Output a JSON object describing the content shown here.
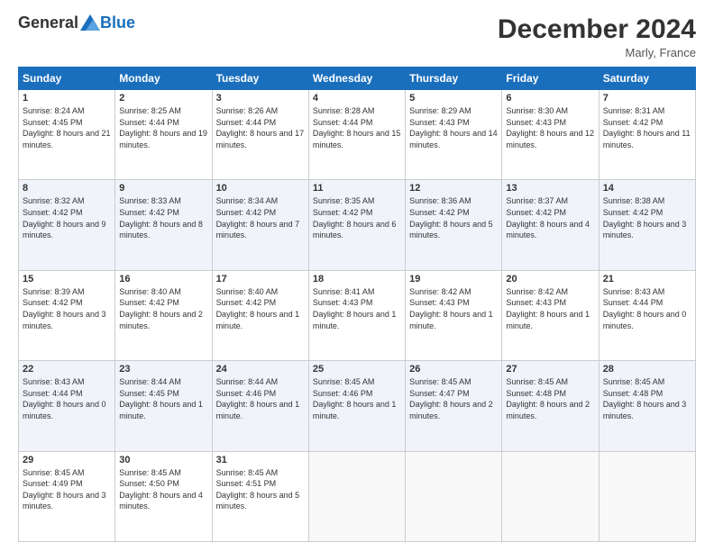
{
  "header": {
    "logo_general": "General",
    "logo_blue": "Blue",
    "month_title": "December 2024",
    "location": "Marly, France"
  },
  "days_of_week": [
    "Sunday",
    "Monday",
    "Tuesday",
    "Wednesday",
    "Thursday",
    "Friday",
    "Saturday"
  ],
  "weeks": [
    [
      {
        "day": "1",
        "info": "Sunrise: 8:24 AM\nSunset: 4:45 PM\nDaylight: 8 hours and 21 minutes."
      },
      {
        "day": "2",
        "info": "Sunrise: 8:25 AM\nSunset: 4:44 PM\nDaylight: 8 hours and 19 minutes."
      },
      {
        "day": "3",
        "info": "Sunrise: 8:26 AM\nSunset: 4:44 PM\nDaylight: 8 hours and 17 minutes."
      },
      {
        "day": "4",
        "info": "Sunrise: 8:28 AM\nSunset: 4:44 PM\nDaylight: 8 hours and 15 minutes."
      },
      {
        "day": "5",
        "info": "Sunrise: 8:29 AM\nSunset: 4:43 PM\nDaylight: 8 hours and 14 minutes."
      },
      {
        "day": "6",
        "info": "Sunrise: 8:30 AM\nSunset: 4:43 PM\nDaylight: 8 hours and 12 minutes."
      },
      {
        "day": "7",
        "info": "Sunrise: 8:31 AM\nSunset: 4:42 PM\nDaylight: 8 hours and 11 minutes."
      }
    ],
    [
      {
        "day": "8",
        "info": "Sunrise: 8:32 AM\nSunset: 4:42 PM\nDaylight: 8 hours and 9 minutes."
      },
      {
        "day": "9",
        "info": "Sunrise: 8:33 AM\nSunset: 4:42 PM\nDaylight: 8 hours and 8 minutes."
      },
      {
        "day": "10",
        "info": "Sunrise: 8:34 AM\nSunset: 4:42 PM\nDaylight: 8 hours and 7 minutes."
      },
      {
        "day": "11",
        "info": "Sunrise: 8:35 AM\nSunset: 4:42 PM\nDaylight: 8 hours and 6 minutes."
      },
      {
        "day": "12",
        "info": "Sunrise: 8:36 AM\nSunset: 4:42 PM\nDaylight: 8 hours and 5 minutes."
      },
      {
        "day": "13",
        "info": "Sunrise: 8:37 AM\nSunset: 4:42 PM\nDaylight: 8 hours and 4 minutes."
      },
      {
        "day": "14",
        "info": "Sunrise: 8:38 AM\nSunset: 4:42 PM\nDaylight: 8 hours and 3 minutes."
      }
    ],
    [
      {
        "day": "15",
        "info": "Sunrise: 8:39 AM\nSunset: 4:42 PM\nDaylight: 8 hours and 3 minutes."
      },
      {
        "day": "16",
        "info": "Sunrise: 8:40 AM\nSunset: 4:42 PM\nDaylight: 8 hours and 2 minutes."
      },
      {
        "day": "17",
        "info": "Sunrise: 8:40 AM\nSunset: 4:42 PM\nDaylight: 8 hours and 1 minute."
      },
      {
        "day": "18",
        "info": "Sunrise: 8:41 AM\nSunset: 4:43 PM\nDaylight: 8 hours and 1 minute."
      },
      {
        "day": "19",
        "info": "Sunrise: 8:42 AM\nSunset: 4:43 PM\nDaylight: 8 hours and 1 minute."
      },
      {
        "day": "20",
        "info": "Sunrise: 8:42 AM\nSunset: 4:43 PM\nDaylight: 8 hours and 1 minute."
      },
      {
        "day": "21",
        "info": "Sunrise: 8:43 AM\nSunset: 4:44 PM\nDaylight: 8 hours and 0 minutes."
      }
    ],
    [
      {
        "day": "22",
        "info": "Sunrise: 8:43 AM\nSunset: 4:44 PM\nDaylight: 8 hours and 0 minutes."
      },
      {
        "day": "23",
        "info": "Sunrise: 8:44 AM\nSunset: 4:45 PM\nDaylight: 8 hours and 1 minute."
      },
      {
        "day": "24",
        "info": "Sunrise: 8:44 AM\nSunset: 4:46 PM\nDaylight: 8 hours and 1 minute."
      },
      {
        "day": "25",
        "info": "Sunrise: 8:45 AM\nSunset: 4:46 PM\nDaylight: 8 hours and 1 minute."
      },
      {
        "day": "26",
        "info": "Sunrise: 8:45 AM\nSunset: 4:47 PM\nDaylight: 8 hours and 2 minutes."
      },
      {
        "day": "27",
        "info": "Sunrise: 8:45 AM\nSunset: 4:48 PM\nDaylight: 8 hours and 2 minutes."
      },
      {
        "day": "28",
        "info": "Sunrise: 8:45 AM\nSunset: 4:48 PM\nDaylight: 8 hours and 3 minutes."
      }
    ],
    [
      {
        "day": "29",
        "info": "Sunrise: 8:45 AM\nSunset: 4:49 PM\nDaylight: 8 hours and 3 minutes."
      },
      {
        "day": "30",
        "info": "Sunrise: 8:45 AM\nSunset: 4:50 PM\nDaylight: 8 hours and 4 minutes."
      },
      {
        "day": "31",
        "info": "Sunrise: 8:45 AM\nSunset: 4:51 PM\nDaylight: 8 hours and 5 minutes."
      },
      null,
      null,
      null,
      null
    ]
  ]
}
